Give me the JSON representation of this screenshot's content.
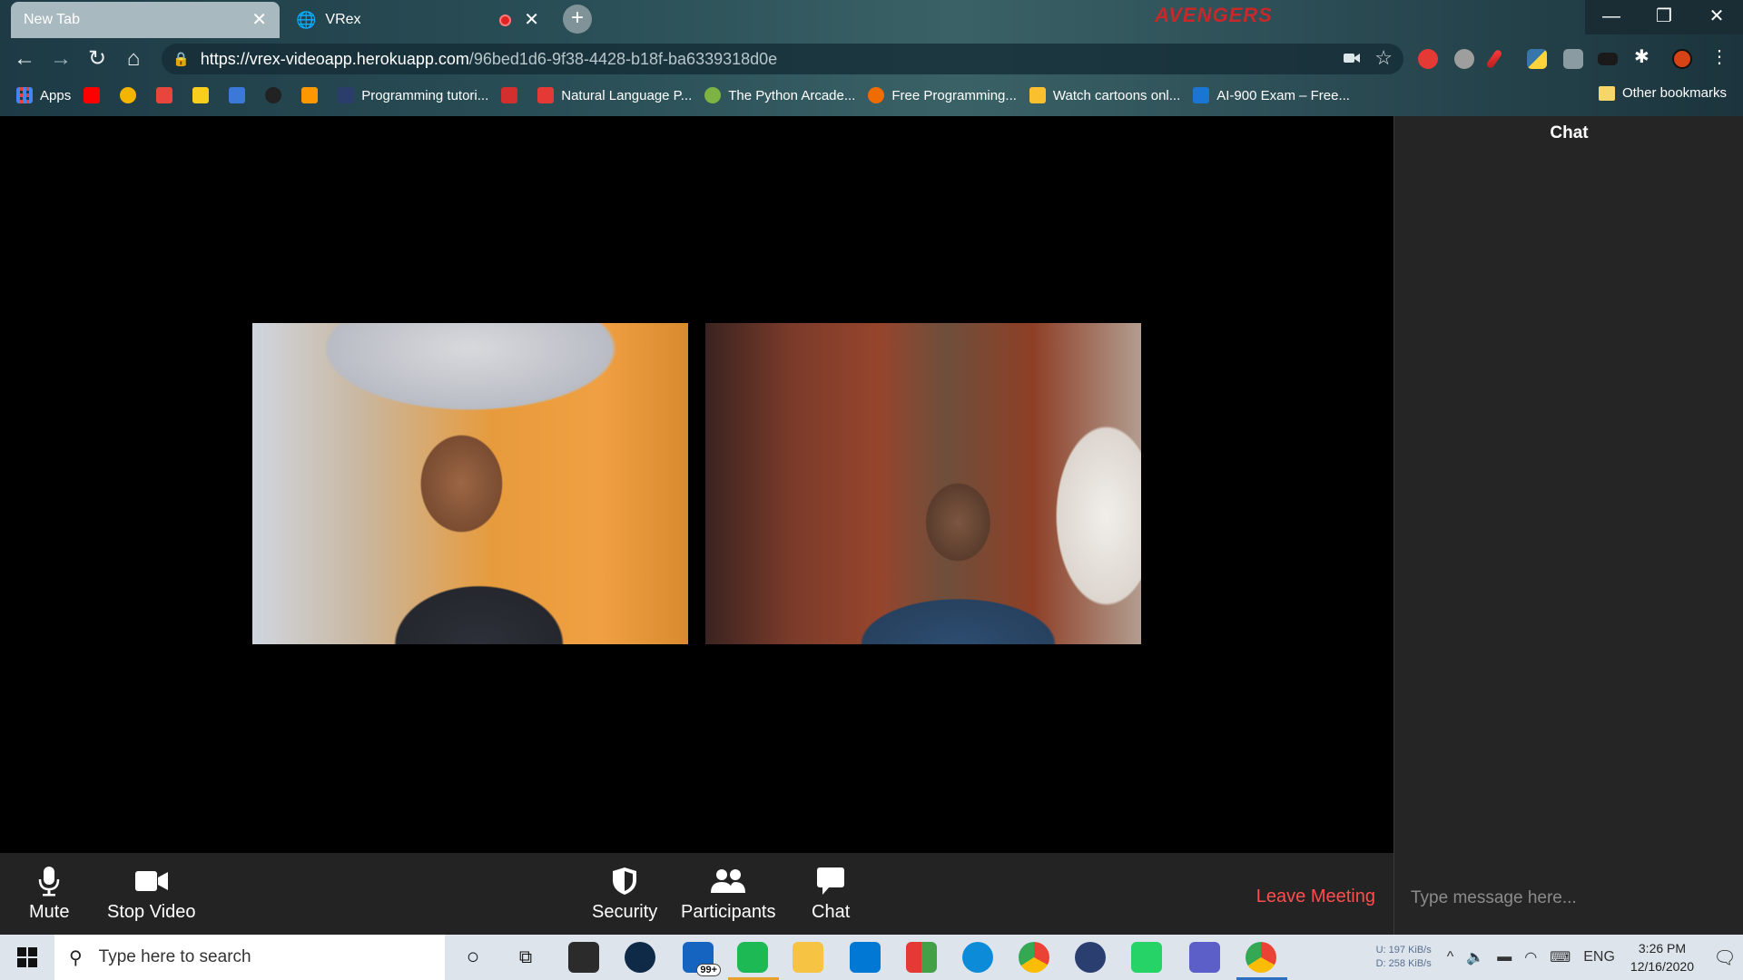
{
  "browser": {
    "tabs": [
      {
        "title": "New Tab",
        "close": "✕"
      },
      {
        "title": "VRex",
        "close": "✕"
      }
    ],
    "new_tab": "+",
    "brand_logo_text": "AVENGERS",
    "window_controls": {
      "minimize": "—",
      "restore": "❐",
      "close": "✕"
    },
    "nav": {
      "back": "←",
      "forward": "→",
      "reload": "↻",
      "home": "⌂"
    },
    "url": {
      "host": "https://vrex-videoapp.herokuapp.com",
      "path": "/96bed1d6-9f38-4428-b18f-ba6339318d0e"
    },
    "bookmarks": [
      {
        "label": "Apps",
        "color": "#4285f4"
      },
      {
        "label": "",
        "color": "#ff0000"
      },
      {
        "label": "",
        "color": "#f4b400"
      },
      {
        "label": "",
        "color": "#e8453c"
      },
      {
        "label": "",
        "color": "#f9ce1d"
      },
      {
        "label": "",
        "color": "#3c78d8"
      },
      {
        "label": "",
        "color": "#222222"
      },
      {
        "label": "",
        "color": "#ff9800"
      },
      {
        "label": "Programming tutori...",
        "color": "#2b3d6b"
      },
      {
        "label": "",
        "color": "#d32f2f"
      },
      {
        "label": "Natural Language P...",
        "color": "#e53935"
      },
      {
        "label": "The Python Arcade...",
        "color": "#7cb342"
      },
      {
        "label": "Free Programming...",
        "color": "#ef6c00"
      },
      {
        "label": "Watch cartoons onl...",
        "color": "#fbc02d"
      },
      {
        "label": "AI-900 Exam – Free...",
        "color": "#1976d2"
      }
    ],
    "other_bookmarks": "Other bookmarks"
  },
  "meeting": {
    "participants": [
      {
        "name": ""
      },
      {
        "name": ""
      }
    ]
  },
  "controls": {
    "mute": "Mute",
    "stop_video": "Stop Video",
    "security": "Security",
    "participants": "Participants",
    "chat": "Chat",
    "leave": "Leave Meeting"
  },
  "chat_panel": {
    "title": "Chat",
    "input_placeholder": "Type message here..."
  },
  "taskbar": {
    "search_placeholder": "Type here to search",
    "mail_badge": "99+",
    "net_upload": "197 KiB/s",
    "net_download": "258 KiB/s",
    "net_up_label": "U:",
    "net_down_label": "D:",
    "language": "ENG",
    "time": "3:26 PM",
    "date": "12/16/2020"
  },
  "colors": {
    "leave": "#ff4d4d",
    "control_bar": "#232323",
    "chat_bg": "#252525"
  }
}
